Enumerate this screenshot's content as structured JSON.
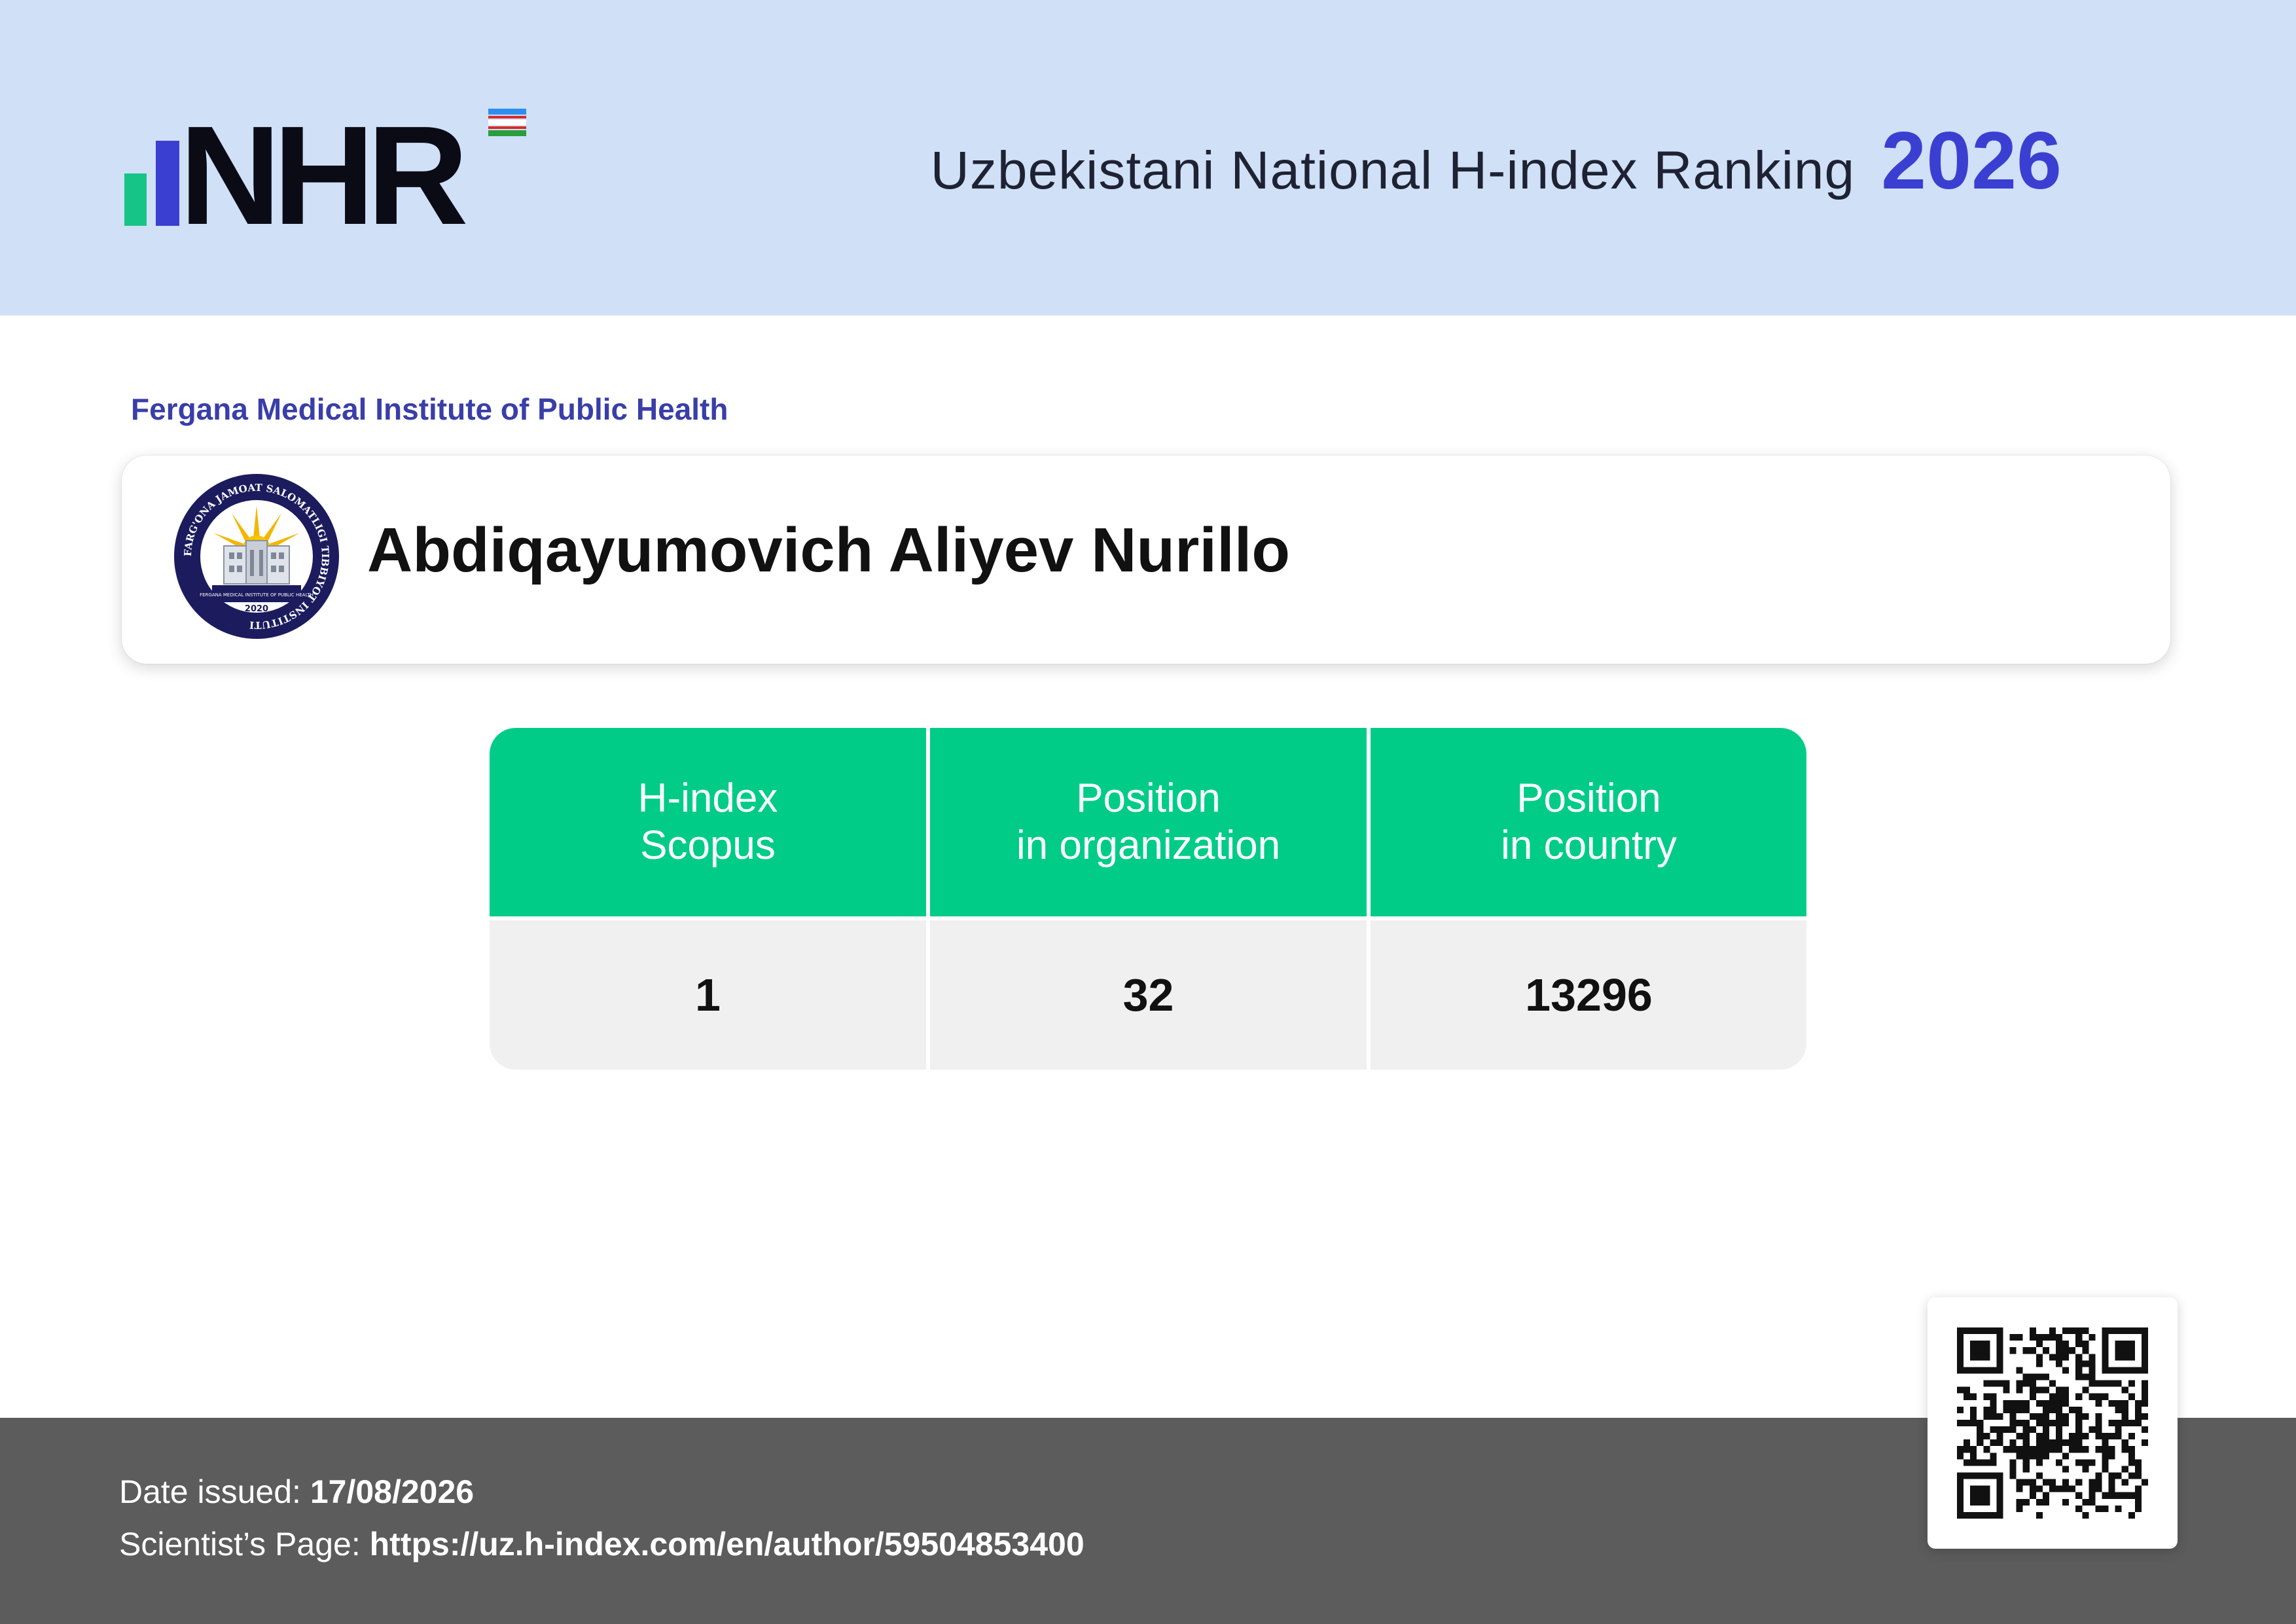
{
  "header": {
    "logo_text": "NHR",
    "title": "Uzbekistani National H-index Ranking",
    "year": "2026"
  },
  "organization": "Fergana Medical Institute of Public Health",
  "seal": {
    "icon": "institute-seal-icon",
    "text_top": "FARG'ONA JAMOAT SALOMATLIGI TIBBIYOT INSTITUTI",
    "text_inner": "FERGANA MEDICAL INSTITUTE OF PUBLIC HEALTH",
    "year": "2020"
  },
  "person": {
    "name": "Abdiqayumovich Aliyev Nurillo"
  },
  "stats": [
    {
      "head_line1": "H-index",
      "head_line2": "Scopus",
      "value": "1"
    },
    {
      "head_line1": "Position",
      "head_line2": "in organization",
      "value": "32"
    },
    {
      "head_line1": "Position",
      "head_line2": "in country",
      "value": "13296"
    }
  ],
  "footer": {
    "date_label": "Date issued:",
    "date_value": "17/08/2026",
    "page_label": "Scientist’s Page:",
    "page_value": "https://uz.h-index.com/en/author/59504853400"
  },
  "qr": {
    "icon": "qr-code-icon"
  },
  "colors": {
    "header_bg": "#cfe0f7",
    "accent_blue": "#3b3fd1",
    "green": "#00cc88",
    "footer_bg": "#5c5c5c"
  }
}
